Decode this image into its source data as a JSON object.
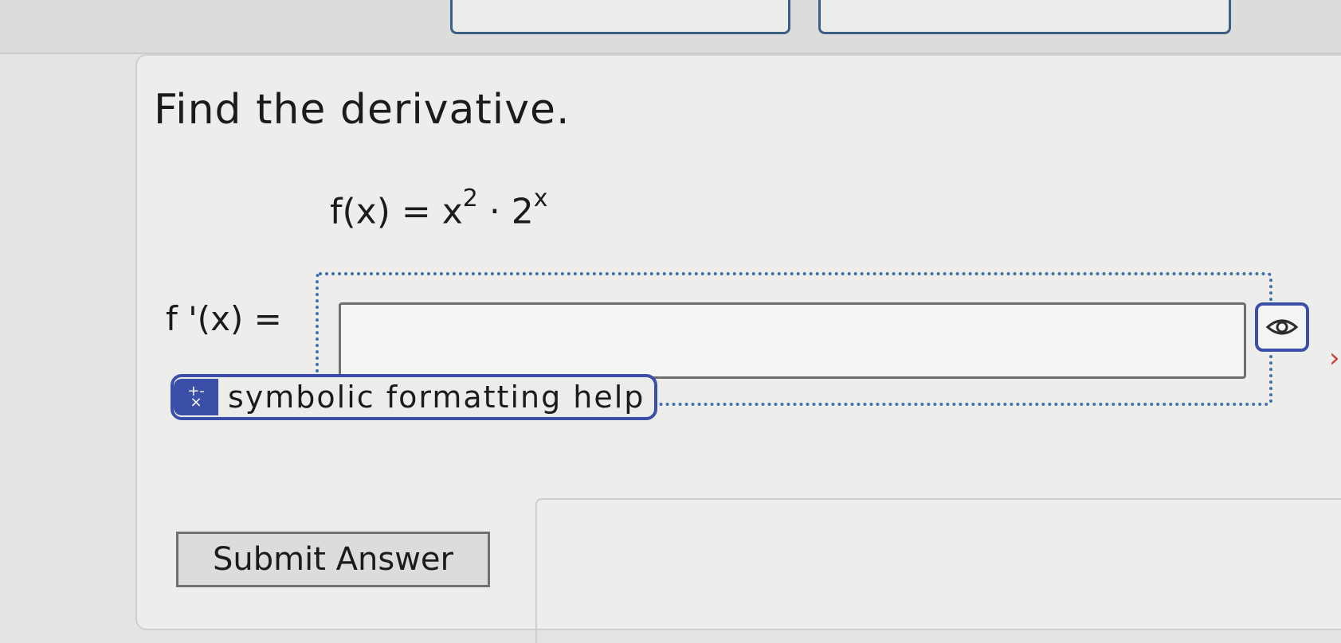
{
  "question": {
    "prompt": "Find the derivative.",
    "function_lhs": "f(x) = x",
    "exponent_1": "2",
    "function_mid": " · 2",
    "exponent_2": "x"
  },
  "answer": {
    "label": "f '(x) =",
    "value": "",
    "placeholder": ""
  },
  "help": {
    "badge_top": "+-",
    "badge_bottom": "×",
    "label": "symbolic formatting help"
  },
  "actions": {
    "submit_label": "Submit Answer"
  },
  "icons": {
    "preview": "eye-icon",
    "help": "plus-minus-icon"
  },
  "colors": {
    "accent": "#3b4fa8",
    "dotted_border": "#3f6fb0",
    "tab_border": "#3d5f84"
  }
}
